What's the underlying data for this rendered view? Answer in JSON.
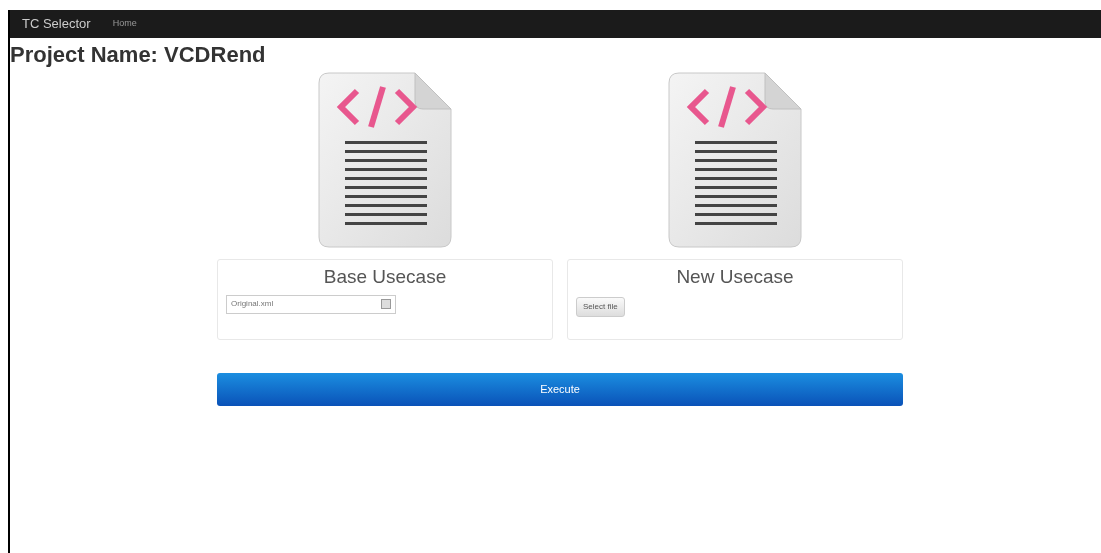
{
  "navbar": {
    "brand": "TC Selector",
    "links": [
      {
        "label": "Home"
      }
    ]
  },
  "title": "Project Name: VCDRend",
  "panels": [
    {
      "title": "Base Usecase",
      "kind": "select",
      "value": "Original.xml"
    },
    {
      "title": "New Usecase",
      "kind": "file",
      "button_label": "Select file"
    }
  ],
  "execute_button": "Execute"
}
